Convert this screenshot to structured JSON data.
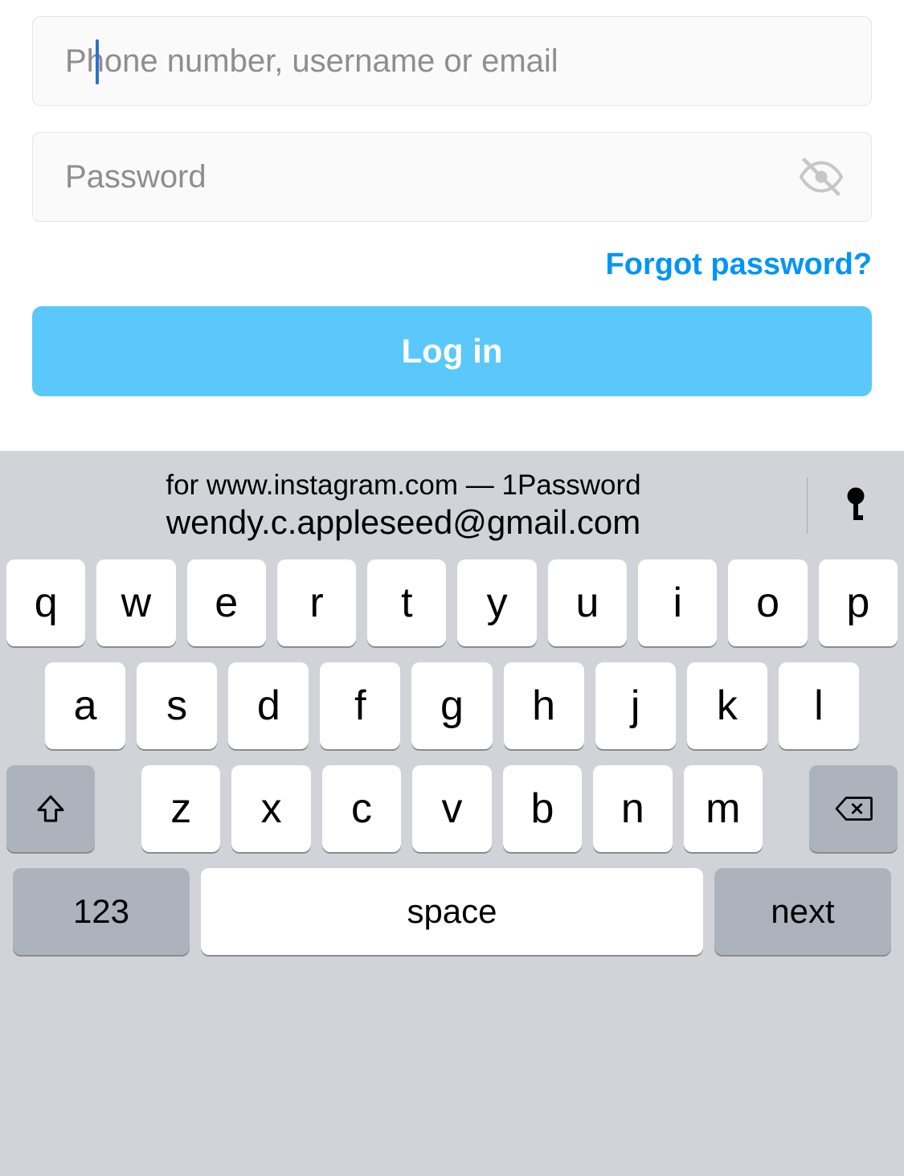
{
  "form": {
    "username_placeholder": "Phone number, username or email",
    "username_value": "",
    "password_placeholder": "Password",
    "password_value": "",
    "forgot_label": "Forgot password?",
    "login_label": "Log in"
  },
  "keyboard": {
    "suggestion_context": "for www.instagram.com — 1Password",
    "suggestion_value": "wendy.c.appleseed@gmail.com",
    "row1": [
      "q",
      "w",
      "e",
      "r",
      "t",
      "y",
      "u",
      "i",
      "o",
      "p"
    ],
    "row2": [
      "a",
      "s",
      "d",
      "f",
      "g",
      "h",
      "j",
      "k",
      "l"
    ],
    "row3": [
      "z",
      "x",
      "c",
      "v",
      "b",
      "n",
      "m"
    ],
    "numeric_label": "123",
    "space_label": "space",
    "next_label": "next"
  }
}
